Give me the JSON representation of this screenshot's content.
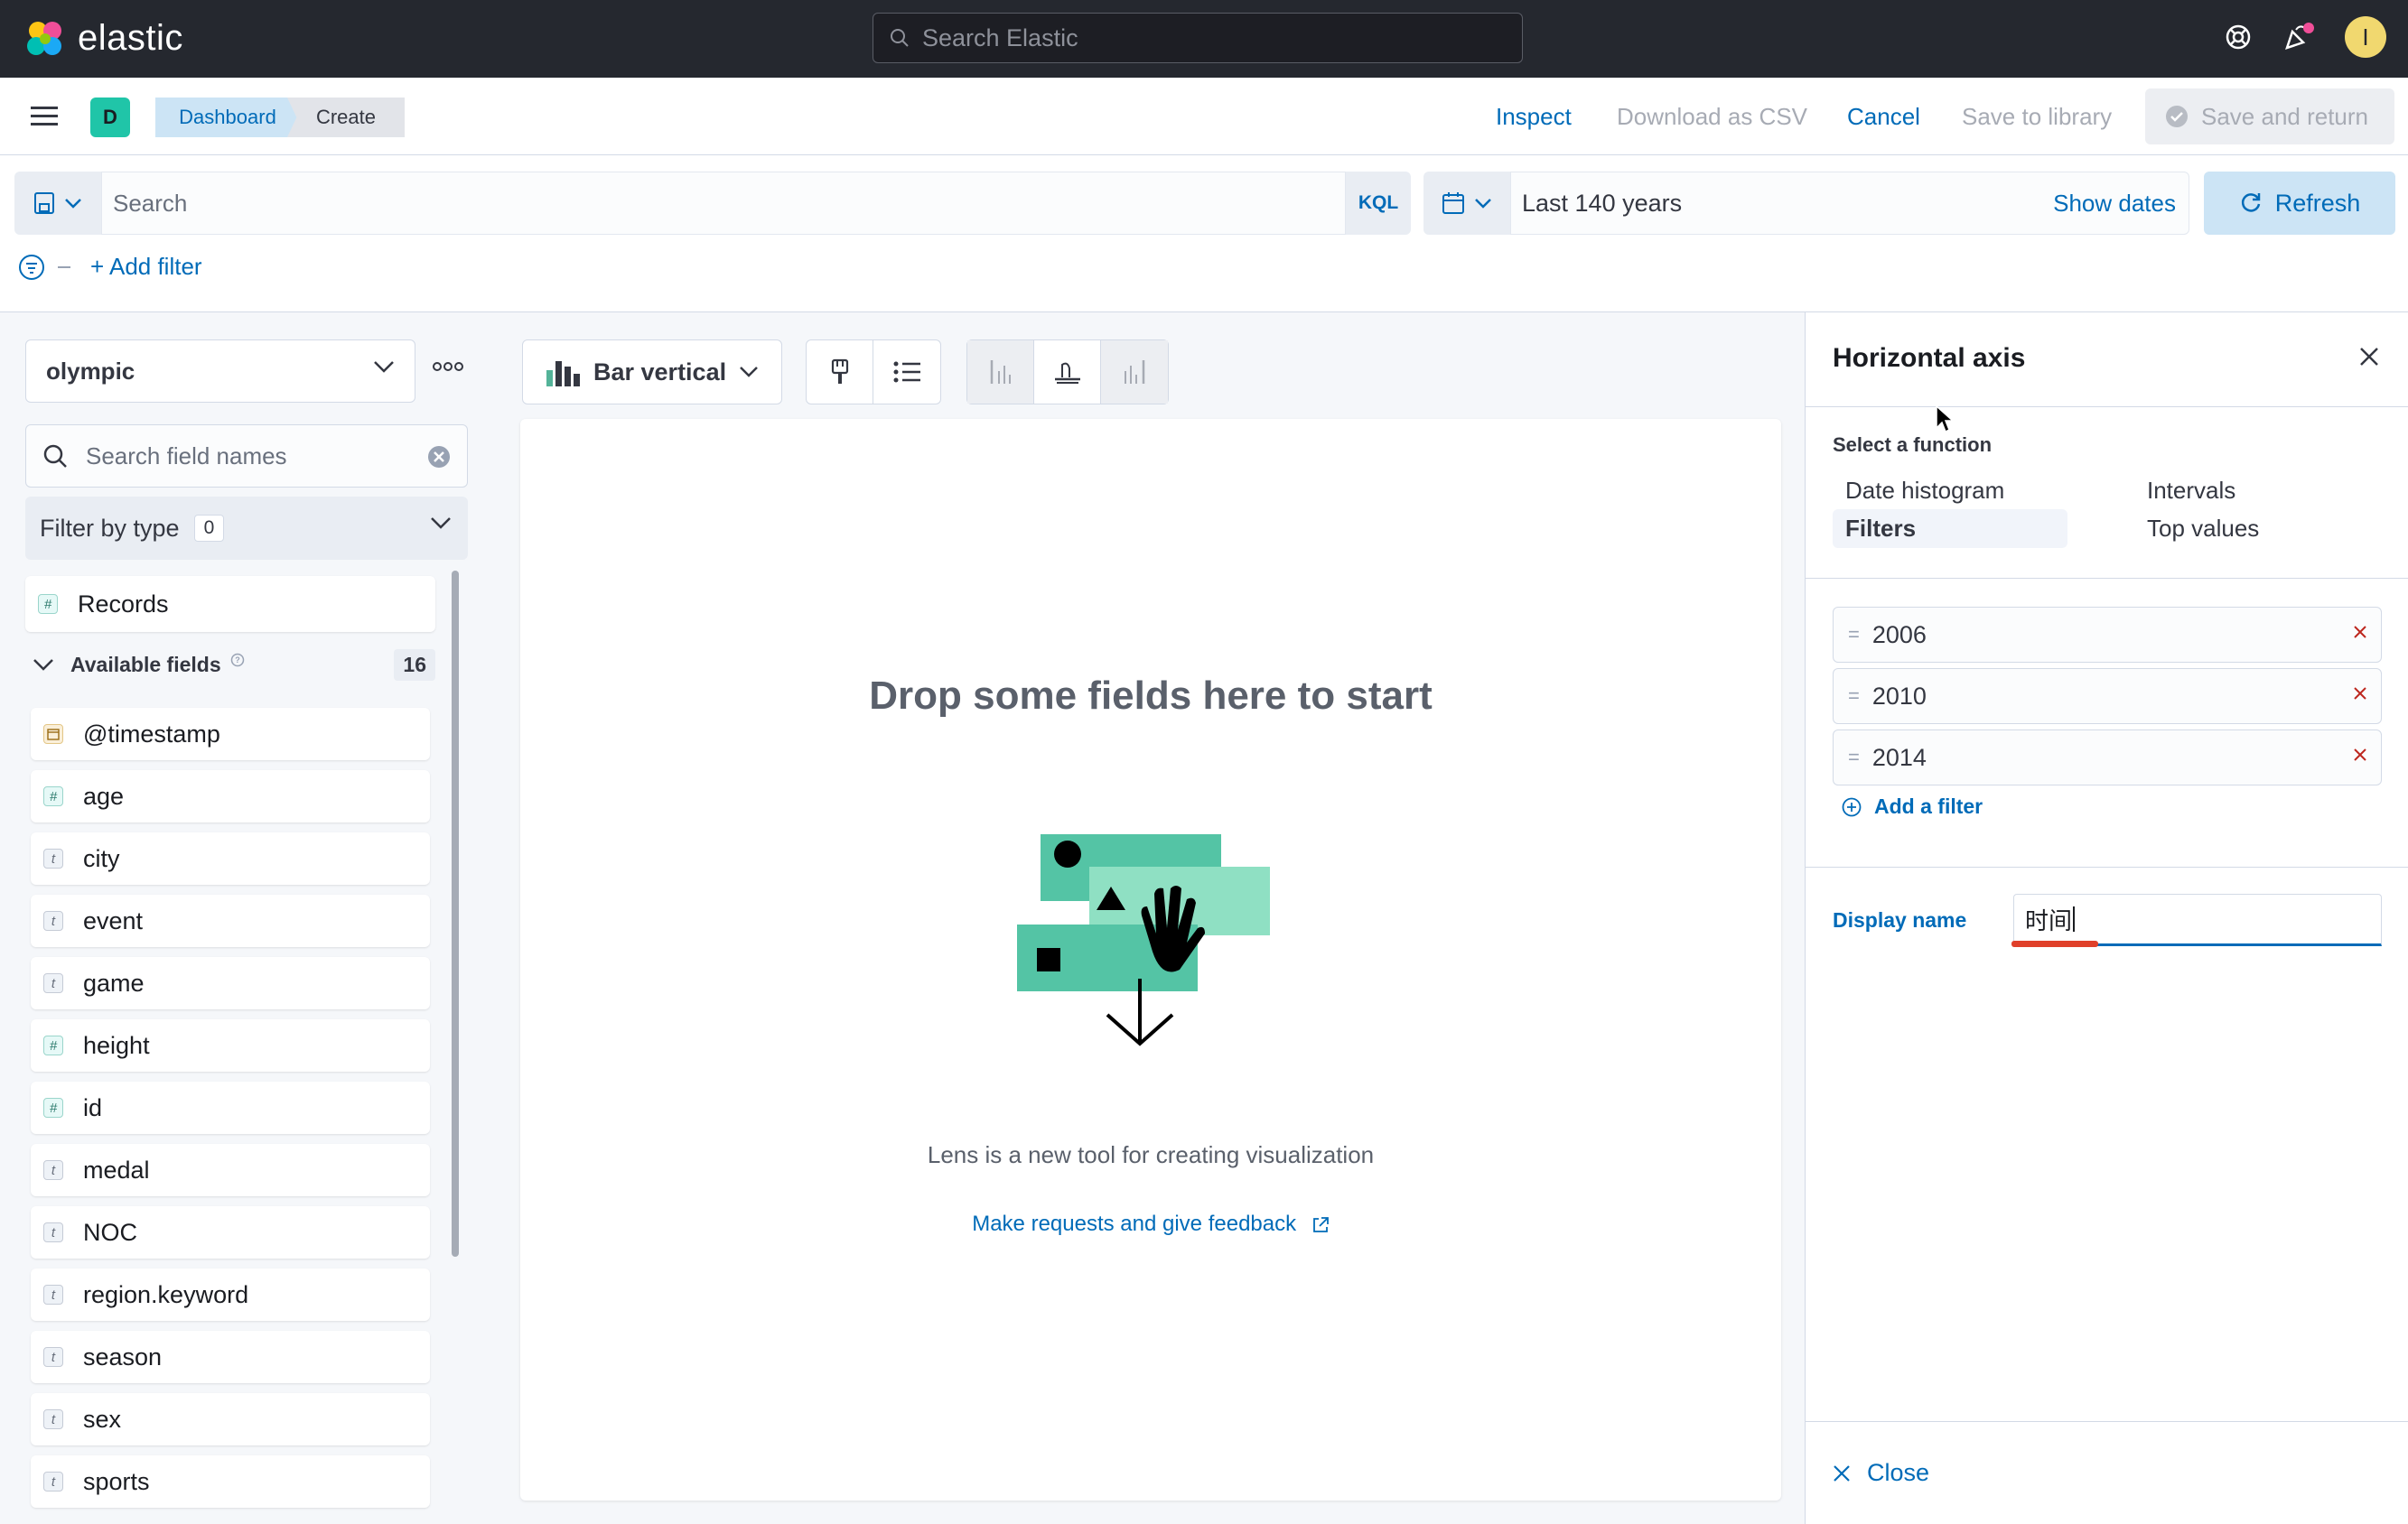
{
  "topbar": {
    "brand": "elastic",
    "search_placeholder": "Search Elastic",
    "avatar_letter": "I",
    "colors": {
      "background": "#25282f",
      "accent": "#006bb8"
    }
  },
  "nav": {
    "space_letter": "D",
    "breadcrumbs": [
      "Dashboard",
      "Create"
    ],
    "inspect": "Inspect",
    "download_csv": "Download as CSV",
    "cancel": "Cancel",
    "save_to_library": "Save to library",
    "save_and_return": "Save and return"
  },
  "query": {
    "search_placeholder": "Search",
    "language": "KQL",
    "time_range": "Last 140 years",
    "show_dates": "Show dates",
    "refresh": "Refresh",
    "add_filter": "+ Add filter"
  },
  "sidebar": {
    "index_pattern": "olympic",
    "field_search_placeholder": "Search field names",
    "filter_by_type": "Filter by type",
    "filter_by_type_count": "0",
    "records": "Records",
    "available_fields_label": "Available fields",
    "available_fields_count": "16",
    "fields": [
      {
        "name": "@timestamp",
        "type": "date",
        "icon": "calendar-token-icon"
      },
      {
        "name": "age",
        "type": "number",
        "icon": "#"
      },
      {
        "name": "city",
        "type": "string",
        "icon": "t"
      },
      {
        "name": "event",
        "type": "string",
        "icon": "t"
      },
      {
        "name": "game",
        "type": "string",
        "icon": "t"
      },
      {
        "name": "height",
        "type": "number",
        "icon": "#"
      },
      {
        "name": "id",
        "type": "number",
        "icon": "#"
      },
      {
        "name": "medal",
        "type": "string",
        "icon": "t"
      },
      {
        "name": "NOC",
        "type": "string",
        "icon": "t"
      },
      {
        "name": "region.keyword",
        "type": "string",
        "icon": "t"
      },
      {
        "name": "season",
        "type": "string",
        "icon": "t"
      },
      {
        "name": "sex",
        "type": "string",
        "icon": "t"
      },
      {
        "name": "sports",
        "type": "string",
        "icon": "t"
      }
    ]
  },
  "workspace": {
    "chart_type": "Bar vertical",
    "drop_title": "Drop some fields here to start",
    "description": "Lens is a new tool for creating visualization",
    "feedback_link": "Make requests and give feedback"
  },
  "flyout": {
    "title": "Horizontal axis",
    "select_function": "Select a function",
    "functions": {
      "date_histogram": "Date histogram",
      "intervals": "Intervals",
      "filters": "Filters",
      "top_values": "Top values"
    },
    "active_function": "Filters",
    "filters": [
      "2006",
      "2010",
      "2014"
    ],
    "add_a_filter": "Add a filter",
    "display_name_label": "Display name",
    "display_name_value": "时间",
    "close": "Close"
  }
}
